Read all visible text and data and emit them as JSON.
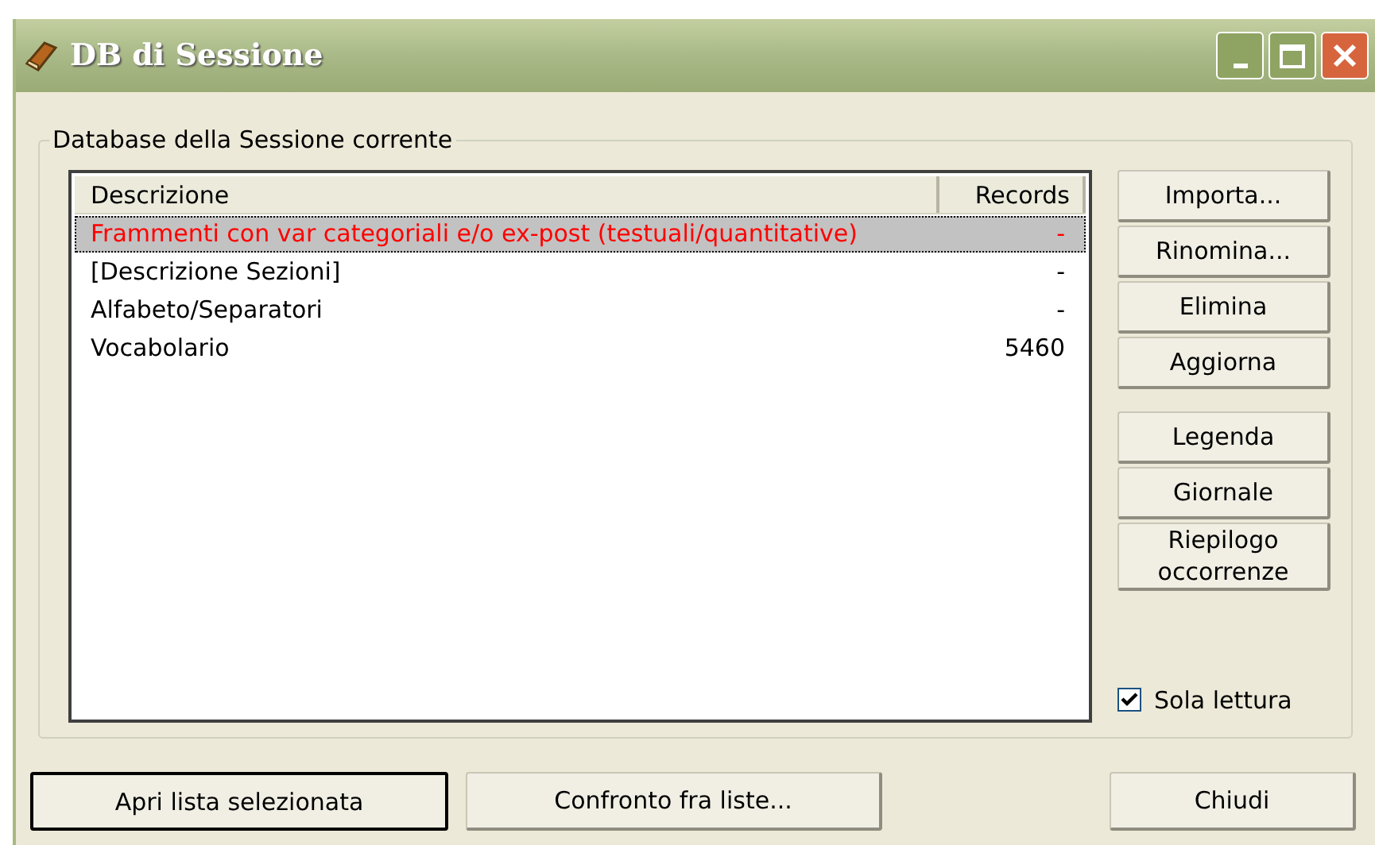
{
  "window": {
    "title": "DB di Sessione"
  },
  "group": {
    "label": "Database della Sessione corrente"
  },
  "table": {
    "columns": [
      "Descrizione",
      "Records"
    ],
    "rows": [
      {
        "descrizione": "Frammenti con var categoriali e/o ex-post (testuali/quantitative)",
        "records": "-",
        "selected": true,
        "color": "#ff0000"
      },
      {
        "descrizione": "[Descrizione Sezioni]",
        "records": "-",
        "selected": false,
        "color": "#000000"
      },
      {
        "descrizione": "Alfabeto/Separatori",
        "records": "-",
        "selected": false,
        "color": "#000000"
      },
      {
        "descrizione": "Vocabolario",
        "records": "5460",
        "selected": false,
        "color": "#000000"
      }
    ]
  },
  "side_button_groups": [
    {
      "buttons": [
        "Importa...",
        "Rinomina...",
        "Elimina",
        "Aggiorna"
      ]
    },
    {
      "buttons": [
        "Legenda",
        "Giornale",
        "Riepilogo occorrenze"
      ]
    }
  ],
  "read_only": {
    "label": "Sola lettura",
    "checked": true
  },
  "bottom_buttons": [
    {
      "label": "Apri lista selezionata",
      "default": true
    },
    {
      "label": "Confronto fra liste...",
      "default": false
    },
    {
      "label": "Chiudi",
      "default": false
    }
  ]
}
